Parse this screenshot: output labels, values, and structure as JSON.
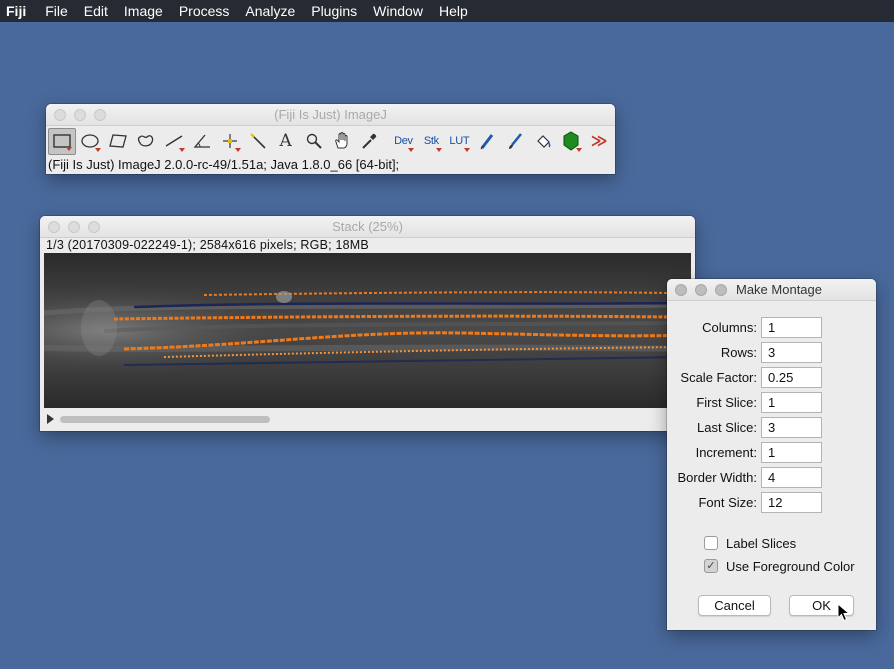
{
  "menubar": {
    "items": [
      "Fiji",
      "File",
      "Edit",
      "Image",
      "Process",
      "Analyze",
      "Plugins",
      "Window",
      "Help"
    ]
  },
  "imagej_window": {
    "title": "(Fiji Is Just) ImageJ",
    "status": "(Fiji Is Just) ImageJ 2.0.0-rc-49/1.51a; Java 1.8.0_66 [64-bit];",
    "tools": {
      "dev": "Dev",
      "stk": "Stk",
      "lut": "LUT",
      "more": "≫",
      "text": "A"
    }
  },
  "stack_window": {
    "title": "Stack (25%)",
    "info": "1/3 (20170309-022249-1); 2584x616 pixels; RGB; 18MB"
  },
  "montage_dialog": {
    "title": "Make Montage",
    "fields": {
      "columns": {
        "label": "Columns:",
        "value": "1"
      },
      "rows": {
        "label": "Rows:",
        "value": "3"
      },
      "scale_factor": {
        "label": "Scale Factor:",
        "value": "0.25"
      },
      "first_slice": {
        "label": "First Slice:",
        "value": "1"
      },
      "last_slice": {
        "label": "Last Slice:",
        "value": "3"
      },
      "increment": {
        "label": "Increment:",
        "value": "1"
      },
      "border_width": {
        "label": "Border Width:",
        "value": "4"
      },
      "font_size": {
        "label": "Font Size:",
        "value": "12"
      }
    },
    "label_slices": {
      "label": "Label Slices",
      "checked": false
    },
    "use_foreground": {
      "label": "Use Foreground Color",
      "checked": true,
      "mark": "✓"
    },
    "cancel_label": "Cancel",
    "ok_label": "OK"
  },
  "colors": {
    "desktop": "#49699c",
    "menubar": "#262a33",
    "fiber_orange": "#f07a1a",
    "fiber_navy": "#1c2554"
  }
}
